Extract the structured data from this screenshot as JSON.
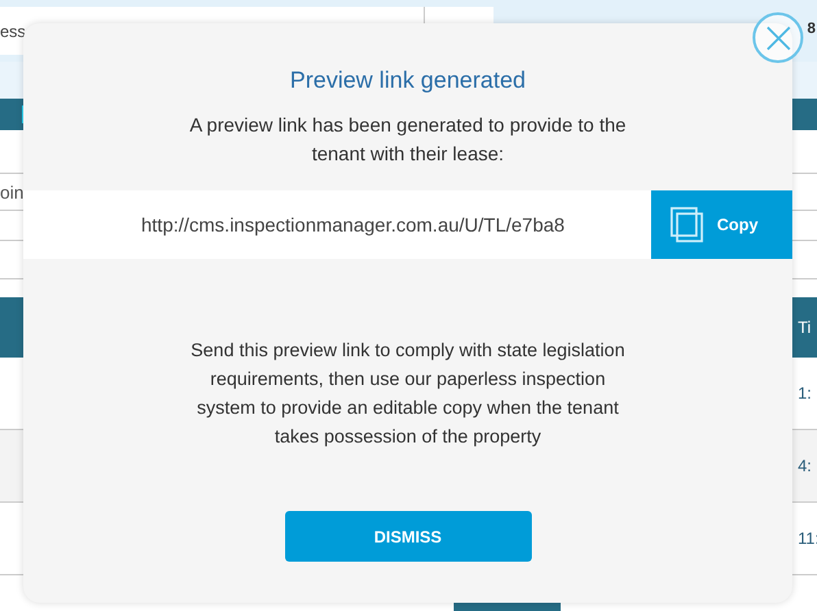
{
  "background": {
    "search": {
      "value": "ess"
    },
    "account_text": "8",
    "list_rows": [
      {
        "kind": "blank"
      },
      {
        "kind": "text",
        "text": "oin"
      },
      {
        "kind": "blank"
      },
      {
        "kind": "blank"
      }
    ],
    "table": {
      "header_visible": "Ti",
      "rows": [
        {
          "time": "1:"
        },
        {
          "time": "4:"
        },
        {
          "time": "11:"
        }
      ],
      "partial_row": {
        "kind": "status-row"
      }
    }
  },
  "modal": {
    "title": "Preview link generated",
    "intro": "A preview link has been generated to provide to the tenant with their lease:",
    "link": "http://cms.inspectionmanager.com.au/U/TL/e7ba8",
    "copy_label": "Copy",
    "body": "Send this preview link to comply with state legislation requirements, then use our paperless inspection system to provide an editable copy when the tenant takes possession of the property",
    "dismiss_label": "DISMISS"
  }
}
